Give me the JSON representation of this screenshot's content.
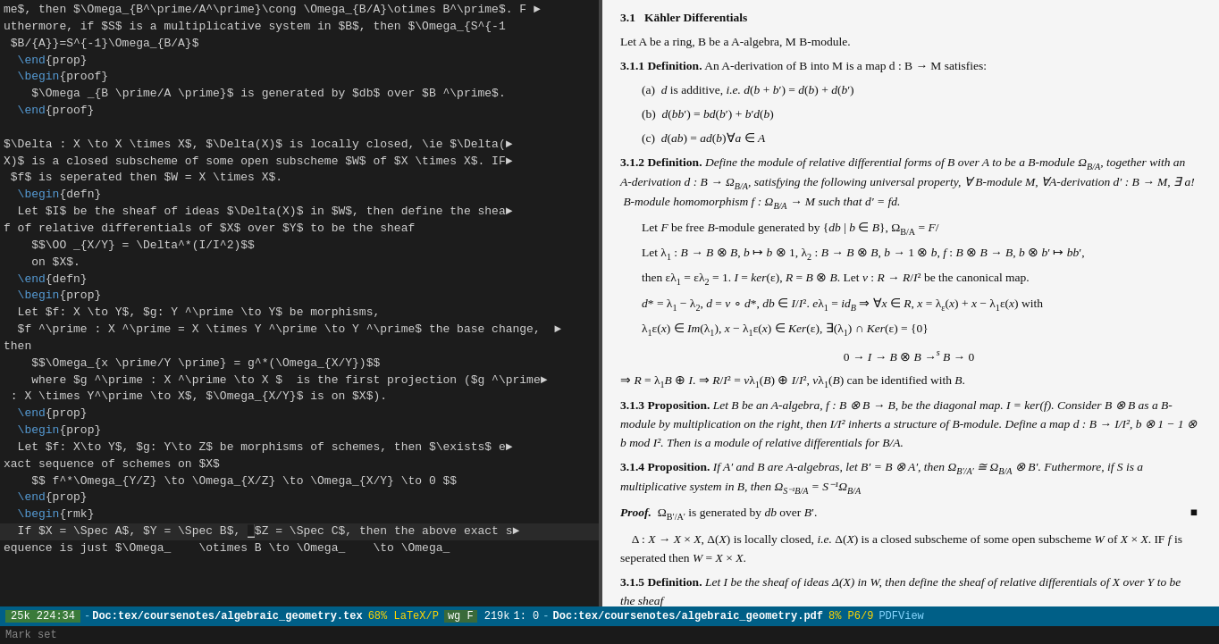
{
  "left_panel": {
    "lines": [
      {
        "text": "me$, then $\\Omega_{B^\\prime/A^\\prime}\\cong \\Omega_{B/A}\\otimes B^\\prime$. F ►",
        "highlight": false
      },
      {
        "text": "uthermore, if $S$ is a multiplicative system in $B$, then $\\Omega_{S^{-1",
        "highlight": false
      },
      {
        "text": " $B/{A}}=S^{-1}\\Omega_{B/A}$",
        "highlight": false
      },
      {
        "text": "  \\end{prop}",
        "highlight": false
      },
      {
        "text": "  \\begin{proof}",
        "highlight": false
      },
      {
        "text": "    $\\Omega_{B \\prime/A \\prime}$ is generated by $db$ over $B ^\\prime$.",
        "highlight": false
      },
      {
        "text": "  \\end{proof}",
        "highlight": false
      },
      {
        "text": "",
        "highlight": false
      },
      {
        "text": "$\\Delta : X \\to X \\times X$, $\\Delta(X)$ is locally closed, \\ie $\\Delta(►",
        "highlight": false
      },
      {
        "text": "X)$ is a closed subscheme of some open subscheme $W$ of $X \\times X$. IF►",
        "highlight": false
      },
      {
        "text": " $f$ is seperated then $W = X \\times X$.",
        "highlight": false
      },
      {
        "text": "  \\begin{defn}",
        "highlight": false
      },
      {
        "text": "  Let $I$ be the sheaf of ideas $\\Delta(X)$ in $W$, then define the shea►",
        "highlight": false
      },
      {
        "text": "f of relative differentials of $X$ over $Y$ to be the sheaf",
        "highlight": false
      },
      {
        "text": "    $$\\OO_{X/Y} = \\Delta^*(I/I^2)$$",
        "highlight": false
      },
      {
        "text": "    on $X$.",
        "highlight": false
      },
      {
        "text": "  \\end{defn}",
        "highlight": false
      },
      {
        "text": "  \\begin{prop}",
        "highlight": false
      },
      {
        "text": "  Let $f: X \\to Y$, $g: Y ^\\prime \\to Y$ be morphisms,",
        "highlight": false
      },
      {
        "text": "  $f ^\\prime : X ^\\prime = X \\times Y ^\\prime \\to Y ^\\prime$ the base change,  ►",
        "highlight": false
      },
      {
        "text": "then",
        "highlight": false
      },
      {
        "text": "    $$\\Omega_{x \\prime/Y \\prime} = g^*(\\Omega_{X/Y})$$",
        "highlight": false
      },
      {
        "text": "    where $g ^\\prime : X ^\\prime \\to X $  is the first projection ($g ^\\prime►",
        "highlight": false
      },
      {
        "text": " : X \\times Y^\\prime \\to X$, $\\Omega_{X/Y}$ is on $X$).",
        "highlight": false
      },
      {
        "text": "  \\end{prop}",
        "highlight": false
      },
      {
        "text": "  \\begin{prop}",
        "highlight": false
      },
      {
        "text": "  Let $f: X\\to Y$, $g: Y\\to Z$ be morphisms of schemes, then $\\exists$ e►",
        "highlight": false
      },
      {
        "text": "xact sequence of schemes on $X$",
        "highlight": false
      },
      {
        "text": "    $$ f^*\\Omega_{Y/Z} \\to \\Omega_{X/Z} \\to \\Omega_{X/Y} \\to 0 $$",
        "highlight": false
      },
      {
        "text": "  \\end{prop}",
        "highlight": false
      },
      {
        "text": "  \\begin{rmk}",
        "highlight": false
      },
      {
        "text": "  If $X = \\Spec A$, $Y = \\Spec B$, █$Z = \\Spec C$, then the above exact s►",
        "highlight": true
      },
      {
        "text": "equence is just $\\Omega_    \\otimes B \\to \\Omega_    \\to \\Omega_",
        "highlight": false
      }
    ]
  },
  "right_panel": {
    "section": "3.1",
    "section_title": "Kähler Differentials",
    "intro": "Let A be a ring, B be a A-algebra, M B-module.",
    "def_311": {
      "label": "3.1.1 Definition.",
      "text": "An A-derivation of B into M is a map d : B → M satisfies:"
    },
    "conditions": [
      {
        "letter": "(a)",
        "text": "d is additive, i.e. d(b + b′) = d(b) + d(b′)"
      },
      {
        "letter": "(b)",
        "text": "d(bb′) = bd(b′) + b′d(b)"
      },
      {
        "letter": "(c)",
        "text": "d(ab) = ad(b)∀a ∈ A"
      }
    ],
    "def_312": {
      "label": "3.1.2 Definition.",
      "text": "Define the module of relative differential forms of B over A to be a B-module Ω_{B/A}, together with an A-derivation d : B → Ω_{B/A}, satisfying the following universal property, ∀ B-module M, ∀A-derivation d′ : B → M, ∃ a! B-module homomorphism f : Ω_{B/A} → M such that d′ = fd."
    },
    "construction": {
      "intro": "Let F be free B-module generated by {db | b ∈ B}, Ω_{B/A} = F/",
      "line1": "Let λ₁ : B → B ⊗ B, b ↦ b ⊗ 1, λ₂ : B → B ⊗ B, b → 1 ⊗ b, f : B ⊗ B → B, b ⊗ b′ ↦ bb′,",
      "line2": "then ελ₁ = ελ₂ = 1. I = ker(ε), R = B ⊗ B. Let v : R → R/I² be the canonical map.",
      "line3": "d* = λ₁ − λ₂, d = v ∘ d*, db ∈ I/I². eλ₁ = id_B ⇒ ∀x ∈ R, x = λ_ε(x) + x − λ₁ε(x) with",
      "line4": "λ₁ε(x) ∈ Im(λ₁), x − λ₁ε(x) ∈ Ker(ε), ∃(λ₁) ∩ Ker(ε) = {0}",
      "exact": "0 → I → B ⊗ B →^s B → 0",
      "conclusion": "⇒ R = λ₁B ⊕ I. ⇒ R/I² = vλ₁(B) ⊕ I/I², vλ₁(B) can be identified with B."
    },
    "prop_313": {
      "label": "3.1.3 Proposition.",
      "text": "Let B be an A-algebra, f : B ⊗ B → B, be the diagonal map. I = ker(f). Consider B ⊗ B as a B-module by multiplication on the right, then I/I² inherts a structure of B-module. Define a map d : B → I/I², b ⊗ 1 − 1 ⊗ b mod I². Then is a module of relative differentials for B/A."
    },
    "prop_314": {
      "label": "3.1.4 Proposition.",
      "text": "If A′ and B are A-algebras, let B′ = B ⊗ A′, then Ω_{B′/A′} ≅ Ω_{B/A} ⊗ B′. Futhermore, if S is a multiplicative system in B, then Ω_{S⁻¹B/A} = S⁻¹Ω_{B/A}"
    },
    "proof_314": {
      "label": "Proof.",
      "text": "Ω_{B′/A′} is generated by db over B′."
    },
    "delta_text": "Δ : X → X × X, Δ(X) is locally closed, i.e. Δ(X) is a closed subscheme of some open subscheme W of X × X. IF f is seperated then W = X × X.",
    "def_315": {
      "label": "3.1.5 Definition.",
      "text": "Let I be the sheaf of ideas Δ(X) in W, then define the sheaf of relative differentials of X over Y to be the sheaf"
    }
  },
  "status_bar": {
    "position": "25k 224:34",
    "separator": "-",
    "left_file": "Doc:tex/coursenotes/algebraic_geometry.tex",
    "mode": "68% LaTeX/P",
    "wg": "wg F",
    "right_size": "219k",
    "line_col": "1:  0",
    "separator2": "-",
    "right_file": "Doc:tex/coursenotes/algebraic_geometry.pdf",
    "percentage": "8% P6/9",
    "viewer": "PDFView"
  },
  "mini_status": {
    "text": "Mark set"
  }
}
